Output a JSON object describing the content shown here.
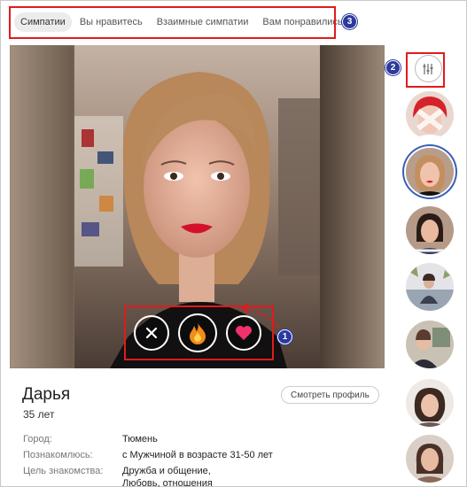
{
  "tabs": [
    {
      "label": "Симпатии",
      "active": true
    },
    {
      "label": "Вы нравитесь",
      "active": false
    },
    {
      "label": "Взаимные симпатии",
      "active": false
    },
    {
      "label": "Вам понравились",
      "active": false
    }
  ],
  "annotations": {
    "one": "1",
    "two": "2",
    "three": "3"
  },
  "profile": {
    "name": "Дарья",
    "age": "35 лет",
    "view_profile": "Смотреть профиль",
    "city_label": "Город:",
    "city_value": "Тюмень",
    "meet_label": "Познакомлюсь:",
    "meet_value": "с Мужчиной в возрасте 31-50 лет",
    "goal_label": "Цель знакомства:",
    "goal_value_1": "Дружба и общение,",
    "goal_value_2": "Любовь, отношения"
  },
  "actions": [
    "close-icon",
    "fire-icon",
    "heart-icon"
  ],
  "colors": {
    "accent": "#3b5fb7",
    "highlight": "#e01b1b",
    "badge": "#2b3a9c"
  }
}
